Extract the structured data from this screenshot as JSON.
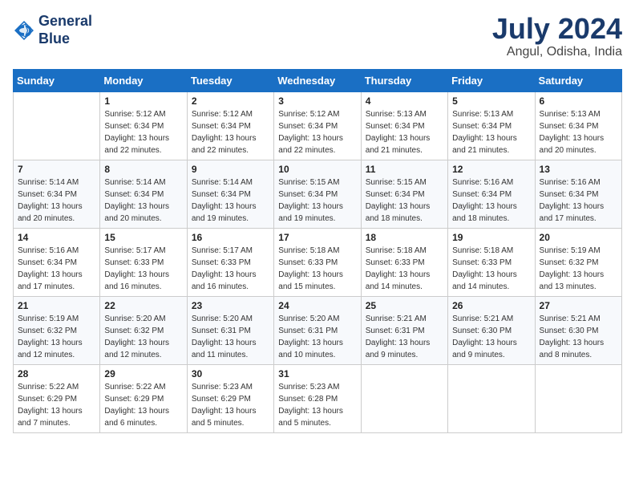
{
  "logo": {
    "line1": "General",
    "line2": "Blue"
  },
  "title": "July 2024",
  "subtitle": "Angul, Odisha, India",
  "days_of_week": [
    "Sunday",
    "Monday",
    "Tuesday",
    "Wednesday",
    "Thursday",
    "Friday",
    "Saturday"
  ],
  "weeks": [
    [
      {
        "day": "",
        "info": ""
      },
      {
        "day": "1",
        "info": "Sunrise: 5:12 AM\nSunset: 6:34 PM\nDaylight: 13 hours\nand 22 minutes."
      },
      {
        "day": "2",
        "info": "Sunrise: 5:12 AM\nSunset: 6:34 PM\nDaylight: 13 hours\nand 22 minutes."
      },
      {
        "day": "3",
        "info": "Sunrise: 5:12 AM\nSunset: 6:34 PM\nDaylight: 13 hours\nand 22 minutes."
      },
      {
        "day": "4",
        "info": "Sunrise: 5:13 AM\nSunset: 6:34 PM\nDaylight: 13 hours\nand 21 minutes."
      },
      {
        "day": "5",
        "info": "Sunrise: 5:13 AM\nSunset: 6:34 PM\nDaylight: 13 hours\nand 21 minutes."
      },
      {
        "day": "6",
        "info": "Sunrise: 5:13 AM\nSunset: 6:34 PM\nDaylight: 13 hours\nand 20 minutes."
      }
    ],
    [
      {
        "day": "7",
        "info": "Sunrise: 5:14 AM\nSunset: 6:34 PM\nDaylight: 13 hours\nand 20 minutes."
      },
      {
        "day": "8",
        "info": "Sunrise: 5:14 AM\nSunset: 6:34 PM\nDaylight: 13 hours\nand 20 minutes."
      },
      {
        "day": "9",
        "info": "Sunrise: 5:14 AM\nSunset: 6:34 PM\nDaylight: 13 hours\nand 19 minutes."
      },
      {
        "day": "10",
        "info": "Sunrise: 5:15 AM\nSunset: 6:34 PM\nDaylight: 13 hours\nand 19 minutes."
      },
      {
        "day": "11",
        "info": "Sunrise: 5:15 AM\nSunset: 6:34 PM\nDaylight: 13 hours\nand 18 minutes."
      },
      {
        "day": "12",
        "info": "Sunrise: 5:16 AM\nSunset: 6:34 PM\nDaylight: 13 hours\nand 18 minutes."
      },
      {
        "day": "13",
        "info": "Sunrise: 5:16 AM\nSunset: 6:34 PM\nDaylight: 13 hours\nand 17 minutes."
      }
    ],
    [
      {
        "day": "14",
        "info": "Sunrise: 5:16 AM\nSunset: 6:34 PM\nDaylight: 13 hours\nand 17 minutes."
      },
      {
        "day": "15",
        "info": "Sunrise: 5:17 AM\nSunset: 6:33 PM\nDaylight: 13 hours\nand 16 minutes."
      },
      {
        "day": "16",
        "info": "Sunrise: 5:17 AM\nSunset: 6:33 PM\nDaylight: 13 hours\nand 16 minutes."
      },
      {
        "day": "17",
        "info": "Sunrise: 5:18 AM\nSunset: 6:33 PM\nDaylight: 13 hours\nand 15 minutes."
      },
      {
        "day": "18",
        "info": "Sunrise: 5:18 AM\nSunset: 6:33 PM\nDaylight: 13 hours\nand 14 minutes."
      },
      {
        "day": "19",
        "info": "Sunrise: 5:18 AM\nSunset: 6:33 PM\nDaylight: 13 hours\nand 14 minutes."
      },
      {
        "day": "20",
        "info": "Sunrise: 5:19 AM\nSunset: 6:32 PM\nDaylight: 13 hours\nand 13 minutes."
      }
    ],
    [
      {
        "day": "21",
        "info": "Sunrise: 5:19 AM\nSunset: 6:32 PM\nDaylight: 13 hours\nand 12 minutes."
      },
      {
        "day": "22",
        "info": "Sunrise: 5:20 AM\nSunset: 6:32 PM\nDaylight: 13 hours\nand 12 minutes."
      },
      {
        "day": "23",
        "info": "Sunrise: 5:20 AM\nSunset: 6:31 PM\nDaylight: 13 hours\nand 11 minutes."
      },
      {
        "day": "24",
        "info": "Sunrise: 5:20 AM\nSunset: 6:31 PM\nDaylight: 13 hours\nand 10 minutes."
      },
      {
        "day": "25",
        "info": "Sunrise: 5:21 AM\nSunset: 6:31 PM\nDaylight: 13 hours\nand 9 minutes."
      },
      {
        "day": "26",
        "info": "Sunrise: 5:21 AM\nSunset: 6:30 PM\nDaylight: 13 hours\nand 9 minutes."
      },
      {
        "day": "27",
        "info": "Sunrise: 5:21 AM\nSunset: 6:30 PM\nDaylight: 13 hours\nand 8 minutes."
      }
    ],
    [
      {
        "day": "28",
        "info": "Sunrise: 5:22 AM\nSunset: 6:29 PM\nDaylight: 13 hours\nand 7 minutes."
      },
      {
        "day": "29",
        "info": "Sunrise: 5:22 AM\nSunset: 6:29 PM\nDaylight: 13 hours\nand 6 minutes."
      },
      {
        "day": "30",
        "info": "Sunrise: 5:23 AM\nSunset: 6:29 PM\nDaylight: 13 hours\nand 5 minutes."
      },
      {
        "day": "31",
        "info": "Sunrise: 5:23 AM\nSunset: 6:28 PM\nDaylight: 13 hours\nand 5 minutes."
      },
      {
        "day": "",
        "info": ""
      },
      {
        "day": "",
        "info": ""
      },
      {
        "day": "",
        "info": ""
      }
    ]
  ]
}
